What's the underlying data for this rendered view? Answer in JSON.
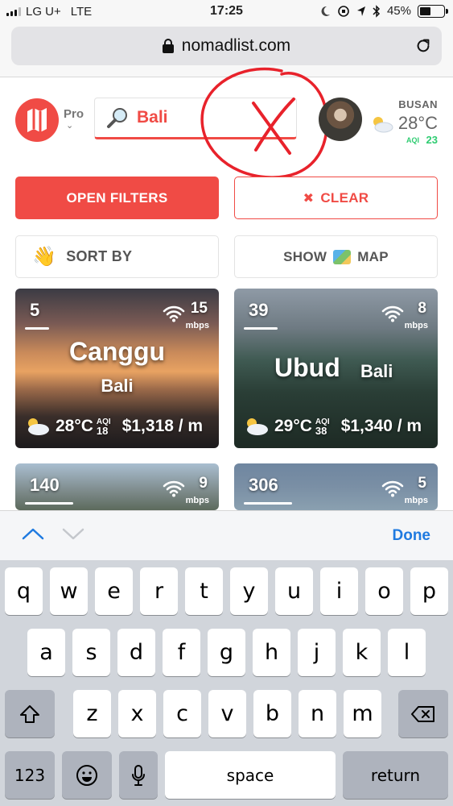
{
  "status_bar": {
    "carrier": "LG U+",
    "network": "LTE",
    "time": "17:25",
    "battery": "45%",
    "battery_level": 0.45
  },
  "browser": {
    "url": "nomadlist.com"
  },
  "header": {
    "pro_label": "Pro",
    "search_value": "Bali",
    "weather": {
      "city": "BUSAN",
      "temp": "28°C",
      "aqi_label": "AQI",
      "aqi_value": "23"
    }
  },
  "buttons": {
    "open_filters": "OPEN FILTERS",
    "clear": "CLEAR",
    "sort_by": "SORT BY",
    "show": "SHOW",
    "map": "MAP"
  },
  "cards": [
    {
      "rank": "5",
      "mbps": "15",
      "mbps_label": "mbps",
      "name": "Canggu",
      "region": "Bali",
      "temp": "28°C",
      "aqi_label": "AQI",
      "aqi": "18",
      "cost": "$1,318 / m"
    },
    {
      "rank": "39",
      "mbps": "8",
      "mbps_label": "mbps",
      "name": "Ubud",
      "region": "Bali",
      "temp": "29°C",
      "aqi_label": "AQI",
      "aqi": "38",
      "cost": "$1,340 / m"
    },
    {
      "rank": "140",
      "mbps": "9",
      "mbps_label": "mbps"
    },
    {
      "rank": "306",
      "mbps": "5",
      "mbps_label": "mbps"
    }
  ],
  "accessory": {
    "done": "Done"
  },
  "keyboard": {
    "row1": [
      "q",
      "w",
      "e",
      "r",
      "t",
      "y",
      "u",
      "i",
      "o",
      "p"
    ],
    "row2": [
      "a",
      "s",
      "d",
      "f",
      "g",
      "h",
      "j",
      "k",
      "l"
    ],
    "row3": [
      "z",
      "x",
      "c",
      "v",
      "b",
      "n",
      "m"
    ],
    "numbers": "123",
    "space": "space",
    "return": "return"
  },
  "colors": {
    "brand": "#f04b45",
    "aqi_good": "#2ecc71",
    "link": "#1f7ae0"
  }
}
